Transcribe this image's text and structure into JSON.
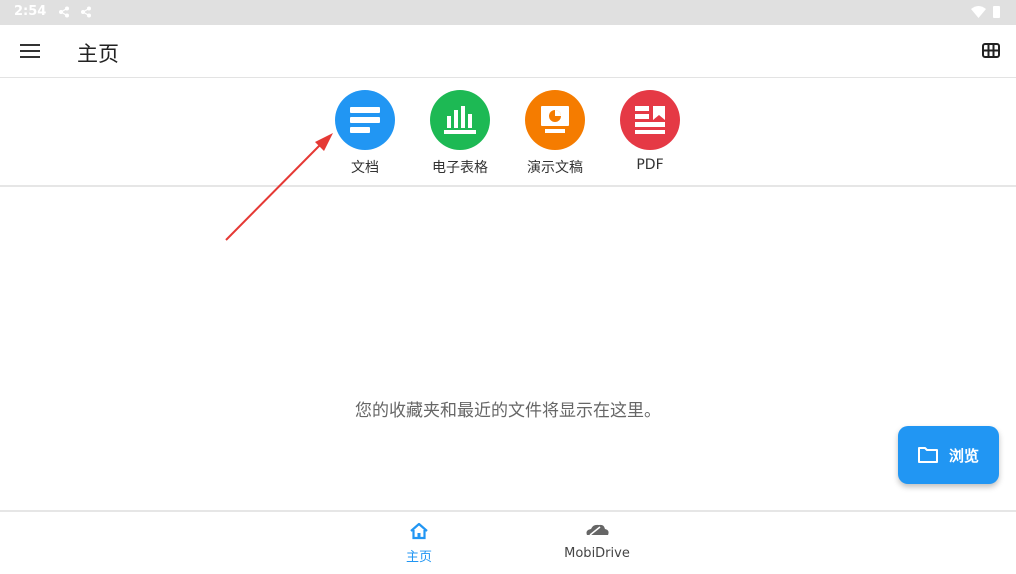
{
  "status_bar": {
    "time": "2:54"
  },
  "app_bar": {
    "title": "主页"
  },
  "shortcuts": [
    {
      "label": "文档",
      "icon": "document-icon",
      "color": "#2196f3"
    },
    {
      "label": "电子表格",
      "icon": "spreadsheet-icon",
      "color": "#1db954"
    },
    {
      "label": "演示文稿",
      "icon": "presentation-icon",
      "color": "#f57c00"
    },
    {
      "label": "PDF",
      "icon": "pdf-icon",
      "color": "#e53945"
    }
  ],
  "empty_message": "您的收藏夹和最近的文件将显示在这里。",
  "fab": {
    "label": "浏览",
    "icon": "folder-icon",
    "color": "#2196f3"
  },
  "bottom_nav": [
    {
      "label": "主页",
      "icon": "home-icon",
      "active": true,
      "color": "#2196f3"
    },
    {
      "label": "MobiDrive",
      "icon": "cloud-icon",
      "active": false,
      "color": "#555555"
    }
  ],
  "annotation": {
    "color": "#e53935"
  }
}
